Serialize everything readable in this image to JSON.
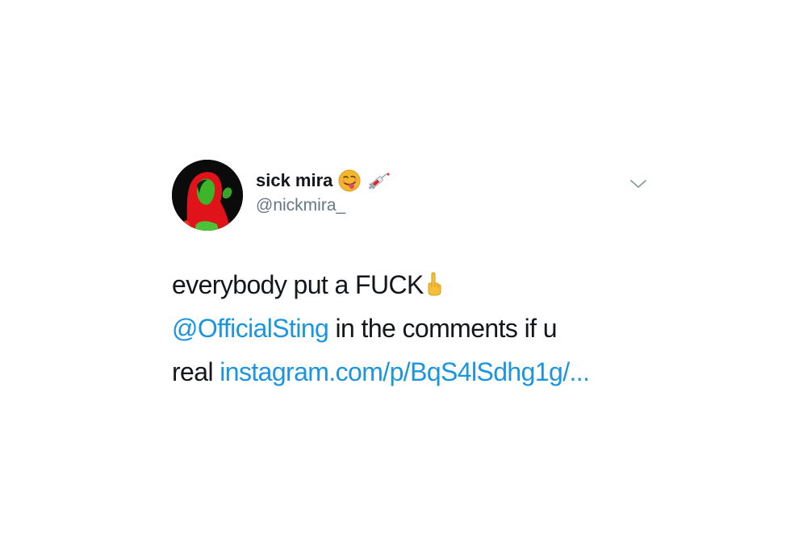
{
  "tweet": {
    "display_name": "sick mira",
    "name_emojis": [
      "face-with-tongue-emoji",
      "syringe-emoji"
    ],
    "handle": "@nickmira_",
    "caret_icon": "chevron-down-icon",
    "text": {
      "line1": "everybody put a FUCK",
      "line1_emoji": "middle-finger-emoji",
      "mention": "@OfficialSting",
      "line2_rest": " in the comments if u",
      "line3_prefix": "real ",
      "link": "instagram.com/p/BqS4lSdhg1g/..."
    }
  },
  "colors": {
    "text": "#14171a",
    "secondary": "#657786",
    "link": "#1b95e0",
    "caret": "#8899a6"
  }
}
